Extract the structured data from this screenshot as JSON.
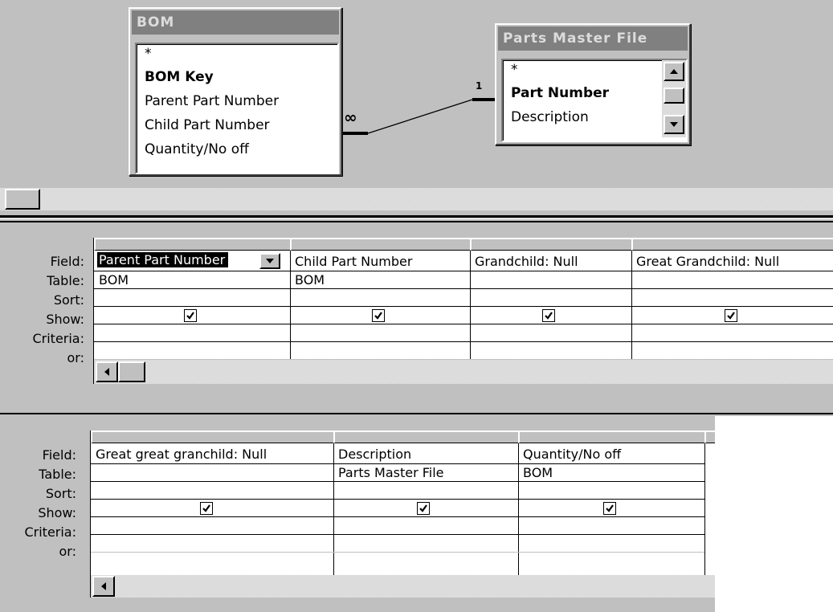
{
  "tables": {
    "bom": {
      "title": "BOM",
      "fields": [
        "*",
        "BOM Key",
        "Parent Part Number",
        "Child Part Number",
        "Quantity/No off"
      ]
    },
    "parts": {
      "title": "Parts Master File",
      "fields": [
        "*",
        "Part Number",
        "Description"
      ]
    }
  },
  "relationship": {
    "one_label": "1",
    "many_label": "∞"
  },
  "row_labels": [
    "Field:",
    "Table:",
    "Sort:",
    "Show:",
    "Criteria:",
    "or:"
  ],
  "grid1": {
    "columns": [
      {
        "field": "Parent Part Number",
        "table": "BOM",
        "sort": "",
        "show": true
      },
      {
        "field": "Child Part Number",
        "table": "BOM",
        "sort": "",
        "show": true
      },
      {
        "field": "Grandchild: Null",
        "table": "",
        "sort": "",
        "show": true
      },
      {
        "field": "Great Grandchild: Null",
        "table": "",
        "sort": "",
        "show": true
      }
    ]
  },
  "grid2": {
    "columns": [
      {
        "field": "Great great granchild: Null",
        "table": "",
        "sort": "",
        "show": true
      },
      {
        "field": "Description",
        "table": "Parts Master File",
        "sort": "",
        "show": true
      },
      {
        "field": "Quantity/No off",
        "table": "BOM",
        "sort": "",
        "show": true
      }
    ]
  }
}
